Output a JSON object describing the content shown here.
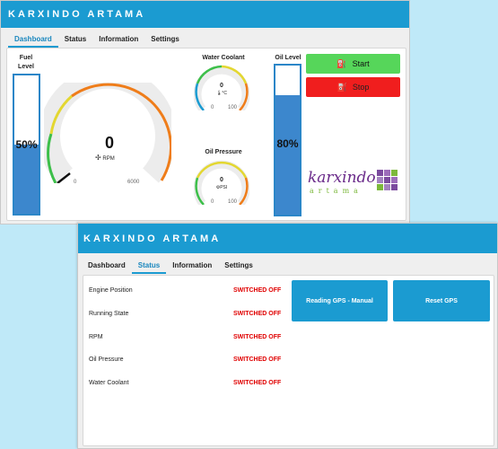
{
  "app_title": "KARXINDO ARTAMA",
  "dashboard_window": {
    "tabs": [
      "Dashboard",
      "Status",
      "Information",
      "Settings"
    ],
    "active_tab": "Dashboard",
    "fuel": {
      "label_line1": "Fuel",
      "label_line2": "Level",
      "value_text": "50%",
      "level": 0.5
    },
    "rpm": {
      "value": "0",
      "unit": "RPM",
      "min": "0",
      "max": "6000"
    },
    "coolant": {
      "title": "Water Coolant",
      "value": "0",
      "unit": "°C",
      "min": "0",
      "max": "100"
    },
    "oil_pressure": {
      "title": "Oil Pressure",
      "value": "0",
      "unit": "PSI",
      "min": "0",
      "max": "100"
    },
    "oil_level": {
      "label": "Oil Level",
      "value_text": "80%",
      "level": 0.8
    },
    "start_label": "Start",
    "stop_label": "Stop",
    "logo": {
      "line1": "karxindo",
      "line2": "artama"
    },
    "colors": {
      "accent": "#1b9bd1",
      "start": "#56d65a",
      "stop": "#f01e1e",
      "gauge_orange": "#ef7d1a",
      "gauge_yellow": "#e3d731",
      "gauge_green": "#3dbf4a"
    }
  },
  "status_window": {
    "tabs": [
      "Dashboard",
      "Status",
      "Information",
      "Settings"
    ],
    "active_tab": "Status",
    "rows": [
      {
        "label": "Engine Position",
        "value": "SWITCHED OFF"
      },
      {
        "label": "Running State",
        "value": "SWITCHED OFF"
      },
      {
        "label": "RPM",
        "value": "SWITCHED OFF"
      },
      {
        "label": "Oil Pressure",
        "value": "SWITCHED OFF"
      },
      {
        "label": "Water Coolant",
        "value": "SWITCHED OFF"
      }
    ],
    "reading_gps_label": "Reading GPS - Manual",
    "reset_gps_label": "Reset GPS"
  }
}
